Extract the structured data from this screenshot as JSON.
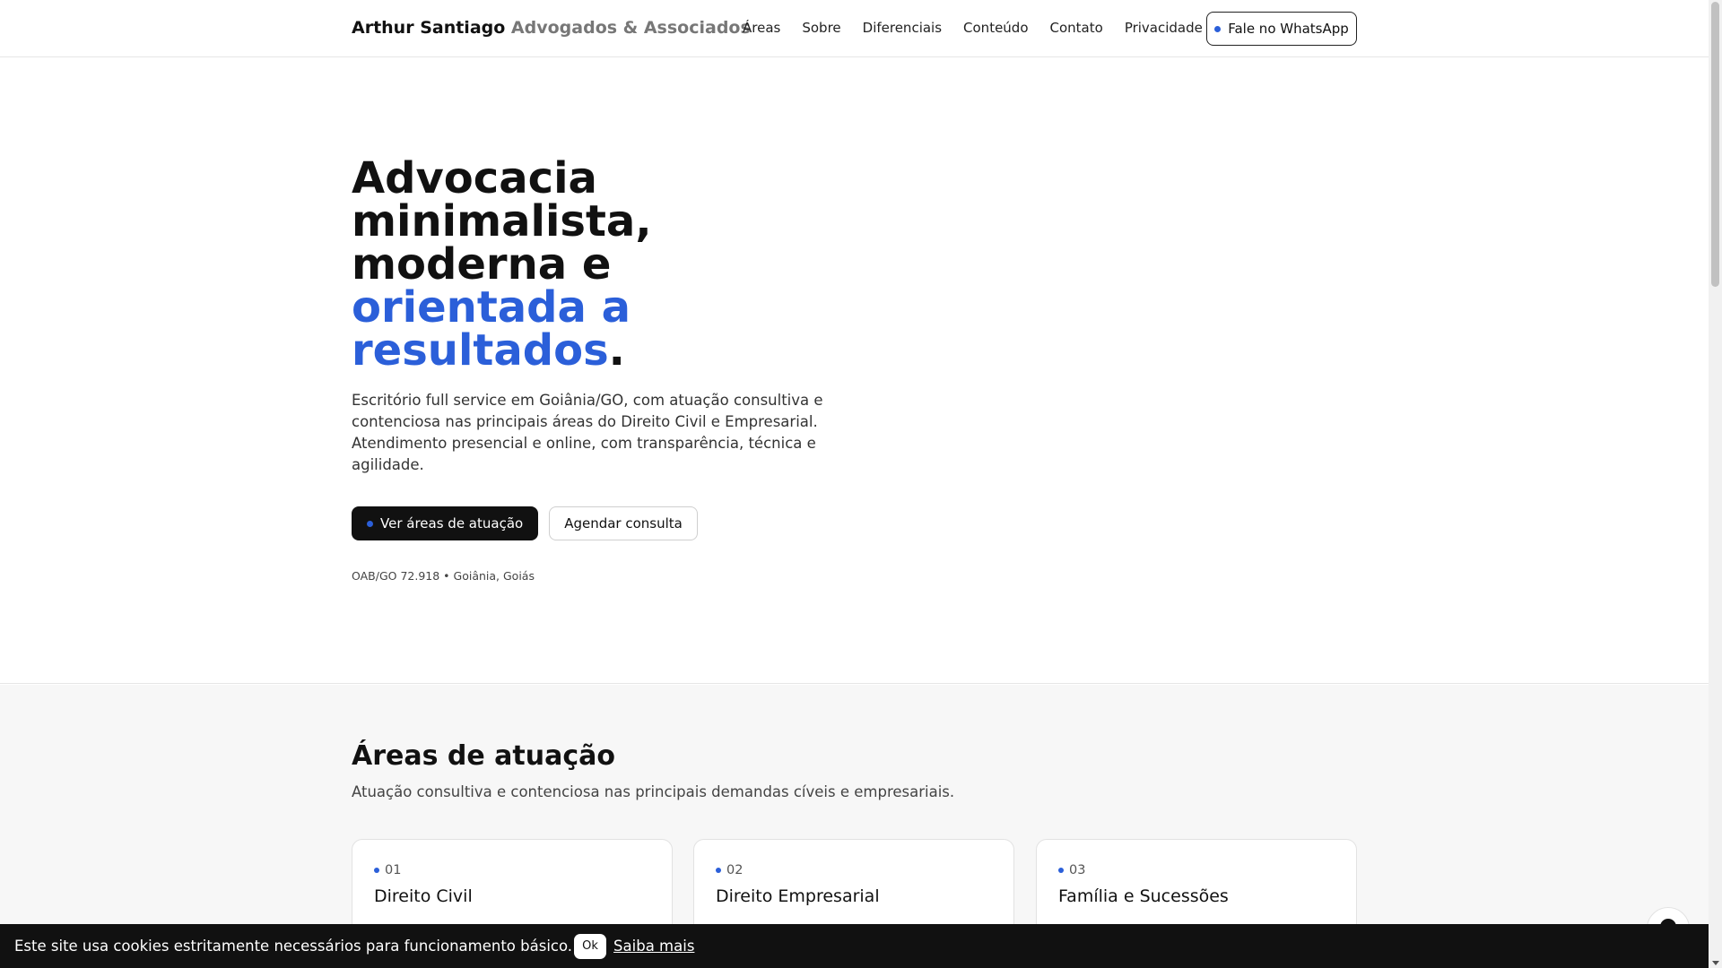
{
  "header": {
    "brand_main": "Arthur Santiago",
    "brand_sub": "Advogados & Associados",
    "nav": [
      "Áreas",
      "Sobre",
      "Diferenciais",
      "Conteúdo",
      "Contato",
      "Privacidade"
    ],
    "whatsapp_label": "Fale no WhatsApp"
  },
  "hero": {
    "title_line1": "Advocacia",
    "title_line2": "minimalista,",
    "title_line3": "moderna e",
    "title_accent1": "orientada a",
    "title_accent2": "resultados",
    "title_end": ".",
    "description": "Escritório full service em Goiânia/GO, com atuação consultiva e contenciosa nas principais áreas do Direito Civil e Empresarial. Atendimento presencial e online, com transparência, técnica e agilidade.",
    "primary_button": "Ver áreas de atuação",
    "secondary_button": "Agendar consulta",
    "meta": "OAB/GO 72.918 • Goiânia, Goiás"
  },
  "areas": {
    "title": "Áreas de atuação",
    "subtitle": "Atuação consultiva e contenciosa nas principais demandas cíveis e empresariais.",
    "cards": [
      {
        "num": "01",
        "title": "Direito Civil"
      },
      {
        "num": "02",
        "title": "Direito Empresarial"
      },
      {
        "num": "03",
        "title": "Família e Sucessões"
      }
    ]
  },
  "cookie": {
    "text": "Este site usa cookies estritamente necessários para funcionamento básico.",
    "ok": "Ok",
    "more": "Saiba mais"
  },
  "colors": {
    "accent": "#2b5fd9",
    "dark": "#111111"
  }
}
